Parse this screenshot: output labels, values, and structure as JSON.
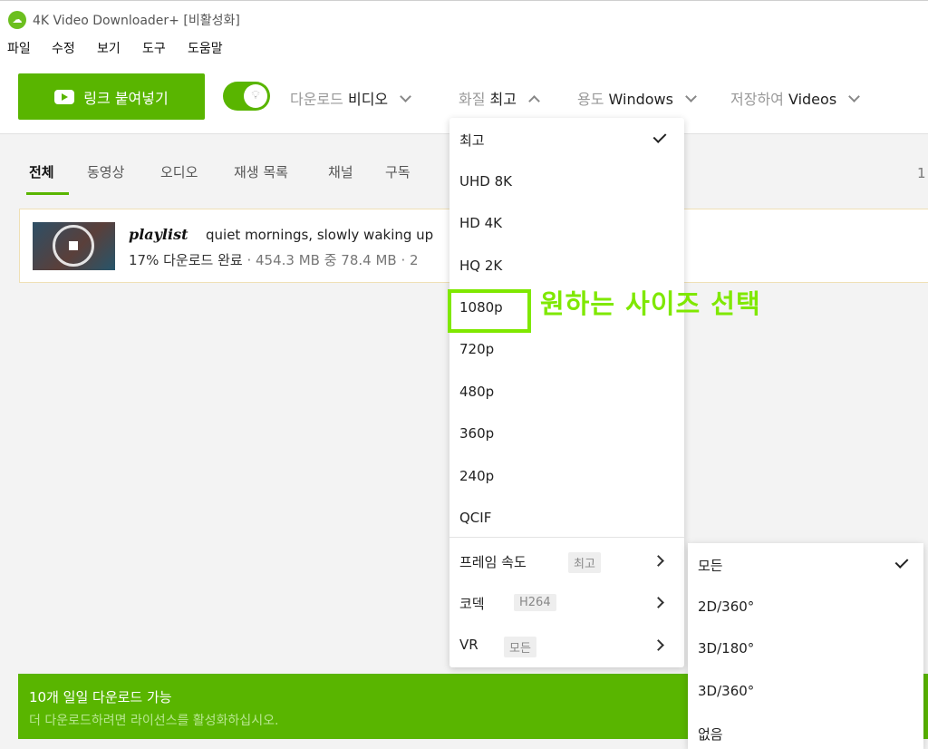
{
  "window": {
    "title": "4K Video Downloader+ [비활성화]"
  },
  "menubar": {
    "items": [
      "파일",
      "수정",
      "보기",
      "도구",
      "도움말"
    ]
  },
  "toolbar": {
    "paste_link": "링크 붙여넣기",
    "download_label": "다운로드",
    "download_value": "비디오",
    "quality_label": "화질",
    "quality_value": "최고",
    "usage_label": "용도",
    "usage_value": "Windows",
    "save_label": "저장하여",
    "save_value": "Videos"
  },
  "tabs": [
    "전체",
    "동영상",
    "오디오",
    "재생 목록",
    "채널",
    "구독"
  ],
  "page_count": "1",
  "download_item": {
    "tag": "playlist",
    "title": "quiet mornings, slowly waking up",
    "progress_text": "17% 다운로드 완료",
    "size_text": "· 454.3 MB 중 78.4 MB · 2",
    "progress_percent": 17
  },
  "quality_menu": {
    "options": [
      "최고",
      "UHD 8K",
      "HD 4K",
      "HQ 2K",
      "1080p",
      "720p",
      "480p",
      "360p",
      "240p",
      "QCIF"
    ],
    "selected": "최고",
    "frame_rate_label": "프레임 속도",
    "frame_rate_value": "최고",
    "codec_label": "코덱",
    "codec_value": "H264",
    "vr_label": "VR",
    "vr_value": "모든"
  },
  "vr_menu": {
    "options": [
      "모든",
      "2D/360°",
      "3D/180°",
      "3D/360°",
      "없음"
    ],
    "selected": "모든"
  },
  "annotation": {
    "text": "원하는 사이즈 선택",
    "highlight_option": "1080p"
  },
  "license_banner": {
    "line1": "10개 일일 다운로드 가능",
    "line2": "더 다운로드하려면 라이선스를 활성화하십시오."
  },
  "colors": {
    "accent": "#59b500",
    "annotation": "#7fe800"
  }
}
